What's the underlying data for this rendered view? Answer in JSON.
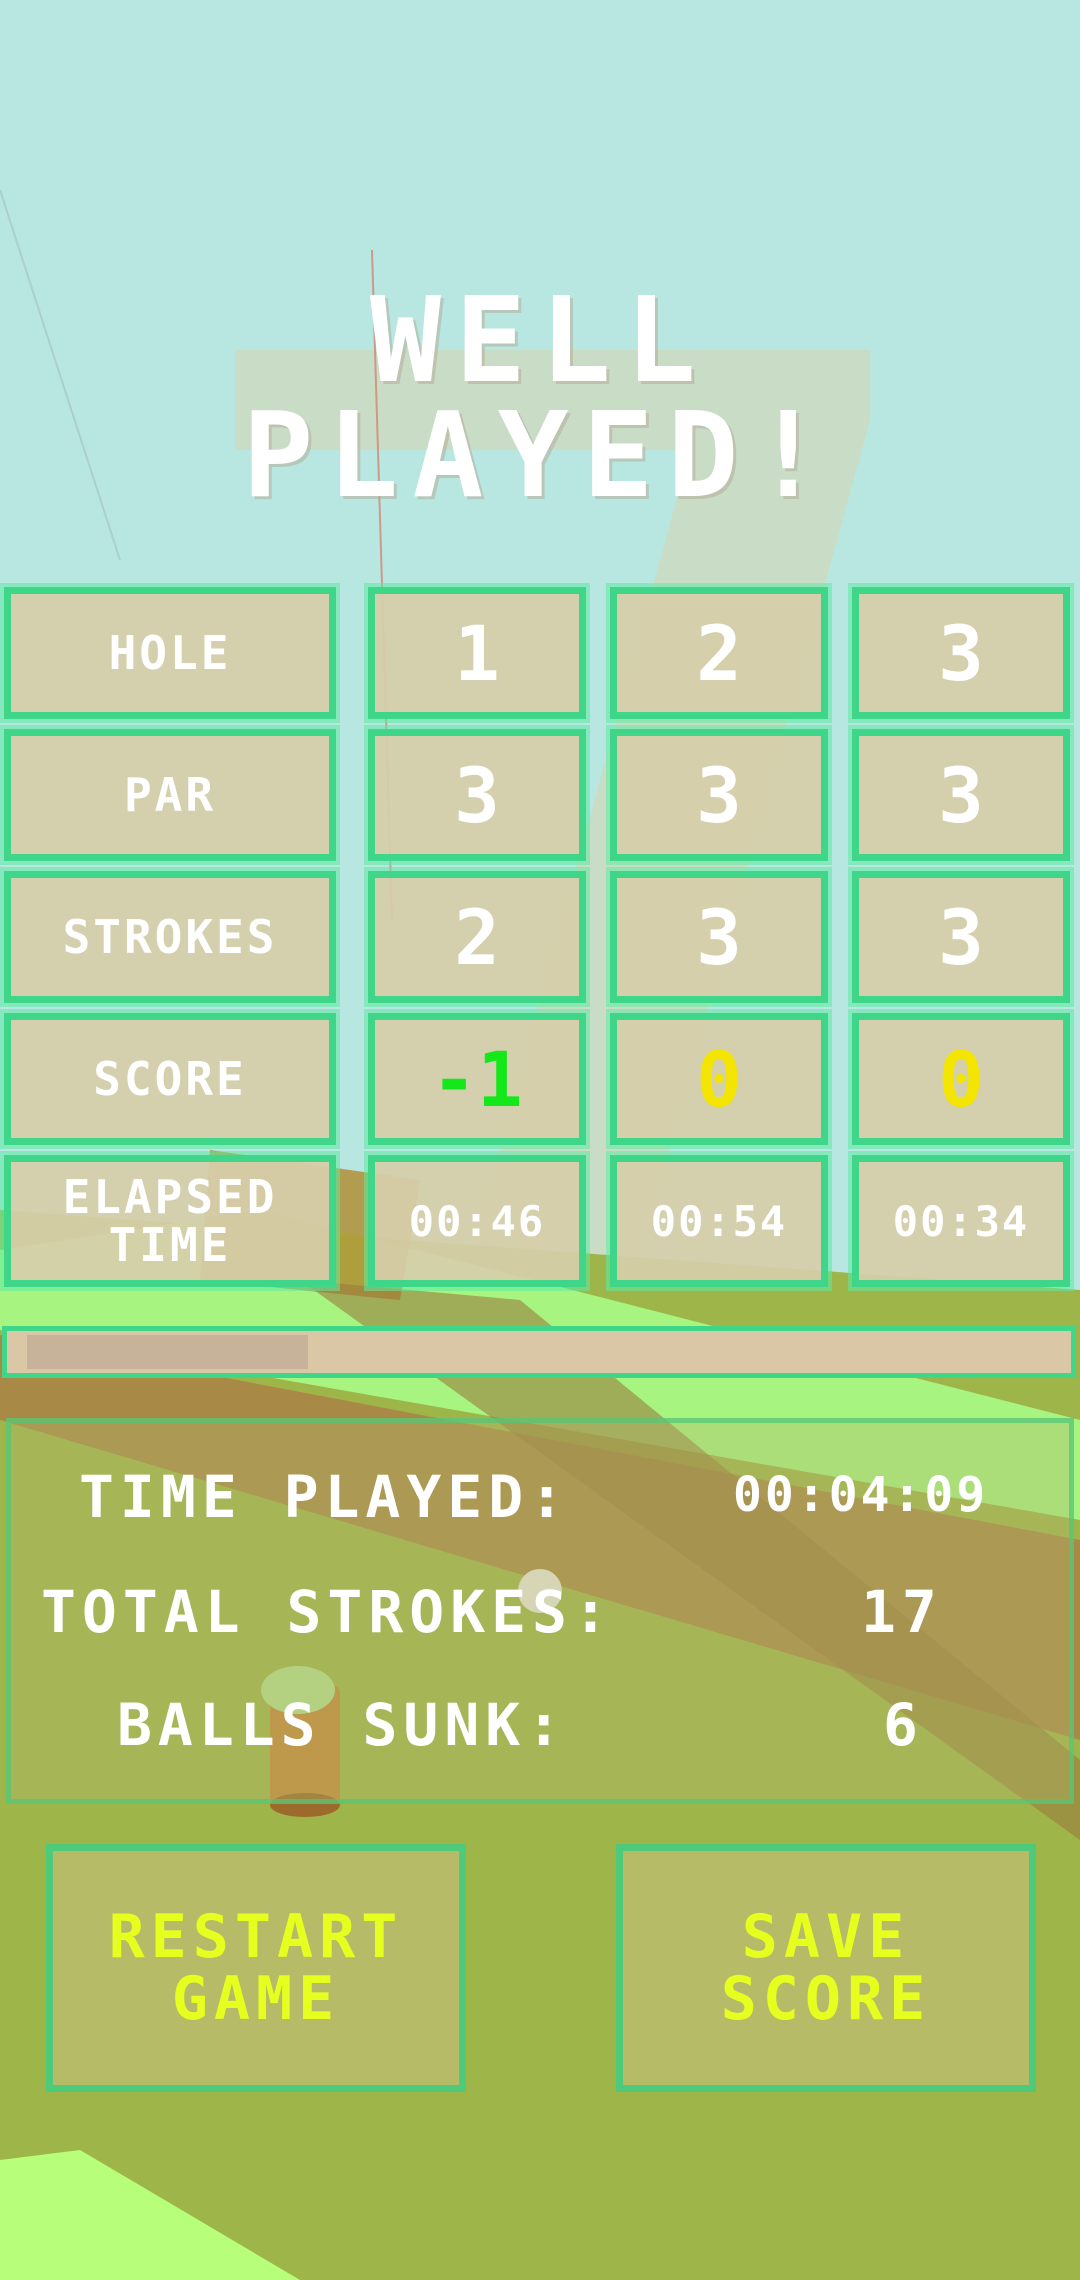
{
  "title": {
    "line1": "WELL",
    "line2": "PLAYED!"
  },
  "scorecard": {
    "row_labels": {
      "hole": "HOLE",
      "par": "PAR",
      "strokes": "STROKES",
      "score": "SCORE",
      "elapsed_1": "ELAPSED",
      "elapsed_2": "TIME"
    },
    "holes": [
      {
        "hole": "1",
        "par": "3",
        "strokes": "2",
        "score": "-1",
        "elapsed": "00:46"
      },
      {
        "hole": "2",
        "par": "3",
        "strokes": "3",
        "score": "0",
        "elapsed": "00:54"
      },
      {
        "hole": "3",
        "par": "3",
        "strokes": "3",
        "score": "0",
        "elapsed": "00:34"
      }
    ]
  },
  "progress": {
    "fraction": 0.27
  },
  "summary": {
    "time_played_label": "TIME PLAYED:",
    "time_played_value": "00:04:09",
    "total_strokes_label": "TOTAL STROKES:",
    "total_strokes_value": "17",
    "balls_sunk_label": "BALLS SUNK:",
    "balls_sunk_value": "6"
  },
  "buttons": {
    "restart_1": "RESTART",
    "restart_2": "GAME",
    "save_1": "SAVE",
    "save_2": "SCORE"
  },
  "colors": {
    "cell_border": "#3fd68a",
    "negative_score": "#15e81a",
    "zero_score": "#f3e500",
    "button_text": "#e6ff1f"
  }
}
